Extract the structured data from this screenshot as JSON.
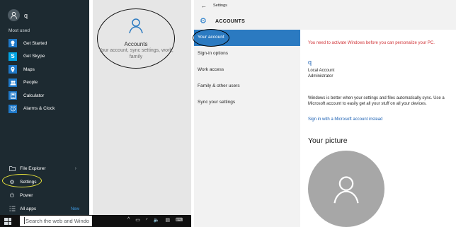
{
  "start_menu": {
    "user_name": "q",
    "most_used_label": "Most used",
    "apps": [
      {
        "label": "Get Started",
        "icon": "lightbulb-icon",
        "color": "#1e78c8",
        "glyph": "💡"
      },
      {
        "label": "Get Skype",
        "icon": "skype-icon",
        "color": "#00a4e4",
        "glyph": "S"
      },
      {
        "label": "Maps",
        "icon": "maps-icon",
        "color": "#1e78c8",
        "glyph": "📍"
      },
      {
        "label": "People",
        "icon": "people-icon",
        "color": "#1e78c8",
        "glyph": "👥"
      },
      {
        "label": "Calculator",
        "icon": "calculator-icon",
        "color": "#1e78c8",
        "glyph": "▦"
      },
      {
        "label": "Alarms & Clock",
        "icon": "alarm-clock-icon",
        "color": "#1e78c8",
        "glyph": "⏰"
      }
    ],
    "file_explorer_label": "File Explorer",
    "settings_label": "Settings",
    "power_label": "Power",
    "all_apps_label": "All apps",
    "new_badge": "New"
  },
  "taskbar": {
    "search_placeholder": "Search the web and Windo"
  },
  "settings_tile": {
    "title": "Accounts",
    "subtitle": "Your account, sync settings, work, family"
  },
  "accounts": {
    "window_title": "Settings",
    "header": "ACCOUNTS",
    "nav": [
      "Your account",
      "Sign-in options",
      "Work access",
      "Family & other users",
      "Sync your settings"
    ],
    "selected_index": 0,
    "activation_warning": "You need to activate Windows before you can personalize your PC.",
    "user_name": "q",
    "account_type": "Local Account",
    "account_role": "Administrator",
    "description": "Windows is better when your settings and files automatically sync. Use a Microsoft account to easily get all your stuff on all your devices.",
    "ms_link": "Sign in with a Microsoft account instead",
    "picture_heading": "Your picture"
  },
  "colors": {
    "accent": "#2b7ac1",
    "warning": "#d13438",
    "link": "#1e62b4",
    "highlight_ellipse": "#e8e23a"
  }
}
